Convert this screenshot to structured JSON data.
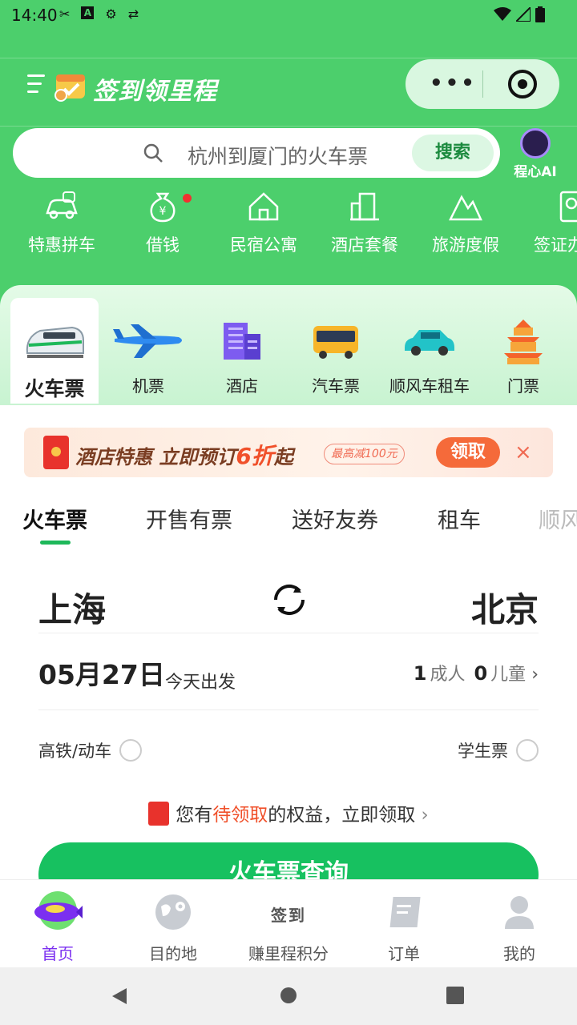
{
  "status_bar": {
    "time": "14:40",
    "notif_a": "A"
  },
  "header": {
    "title": "签到领里程",
    "capsule_dots": "•••"
  },
  "search": {
    "placeholder": "杭州到厦门的火车票",
    "button": "搜索"
  },
  "ai": {
    "label": "程心AI"
  },
  "quick_links": [
    {
      "label": "特惠拼车",
      "icon": "car-share-icon"
    },
    {
      "label": "借钱",
      "icon": "money-bag-icon"
    },
    {
      "label": "民宿公寓",
      "icon": "house-icon"
    },
    {
      "label": "酒店套餐",
      "icon": "hotel-building-icon"
    },
    {
      "label": "旅游度假",
      "icon": "mountain-icon"
    },
    {
      "label": "签证办",
      "icon": "passport-icon"
    }
  ],
  "categories": [
    {
      "label": "火车票",
      "active": true
    },
    {
      "label": "机票"
    },
    {
      "label": "酒店"
    },
    {
      "label": "汽车票"
    },
    {
      "label": "顺风车租车"
    },
    {
      "label": "门票"
    }
  ],
  "promo": {
    "text": "酒店特惠 立即预订",
    "highlight": "6折",
    "suffix": "起",
    "max": "最高减100元",
    "button": "领取",
    "close": "×"
  },
  "tabs": [
    {
      "label": "火车票",
      "active": true
    },
    {
      "label": "开售有票"
    },
    {
      "label": "送好友券"
    },
    {
      "label": "租车"
    },
    {
      "label": "顺风"
    }
  ],
  "booking": {
    "from": "上海",
    "to": "北京",
    "date": "05月27日",
    "date_note": "今天出发",
    "adults": "1",
    "adults_label": "成人",
    "children": "0",
    "children_label": "儿童",
    "option_high_speed": "高铁/动车",
    "option_student": "学生票",
    "benefit_prefix": "您有",
    "benefit_highlight": "待领取",
    "benefit_suffix": "的权益，立即领取",
    "query_button": "火车票查询"
  },
  "bottom_nav": [
    {
      "label": "首页",
      "active": true
    },
    {
      "label": "目的地"
    },
    {
      "label": "赚里程积分",
      "big": "签到"
    },
    {
      "label": "订单"
    },
    {
      "label": "我的"
    }
  ],
  "colors": {
    "brand_green": "#4ccf6c",
    "accent_green": "#17c160",
    "promo_orange": "#f56a3a",
    "active_purple": "#7b2ff0"
  }
}
